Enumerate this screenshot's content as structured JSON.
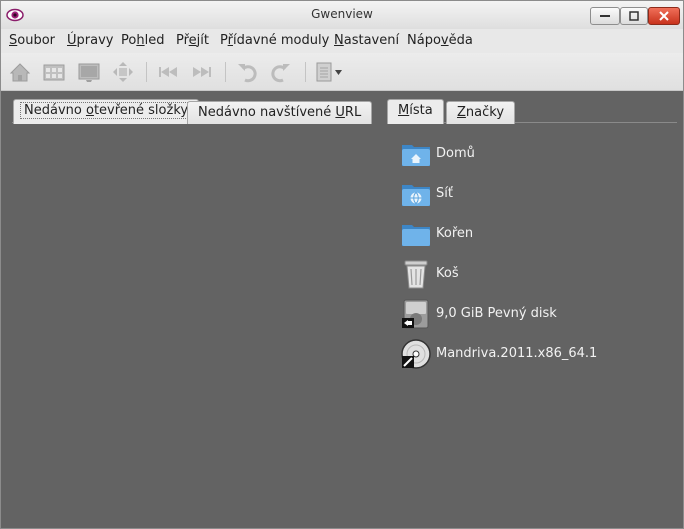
{
  "window": {
    "title": "Gwenview"
  },
  "menu": [
    {
      "pre": "",
      "u": "S",
      "post": "oubor"
    },
    {
      "pre": "",
      "u": "Ú",
      "post": "pravy"
    },
    {
      "pre": "Po",
      "u": "h",
      "post": "led"
    },
    {
      "pre": "Př",
      "u": "e",
      "post": "jít"
    },
    {
      "pre": "P",
      "u": "ř",
      "post": "ídavné moduly"
    },
    {
      "pre": "",
      "u": "N",
      "post": "astavení"
    },
    {
      "pre": "Nápo",
      "u": "v",
      "post": "ěda"
    }
  ],
  "toolbar": {
    "icons": [
      "home-icon",
      "browse-icon",
      "view-icon",
      "fullscreen-icon",
      "first-image-icon",
      "last-image-icon",
      "rotate-left-icon",
      "rotate-right-icon",
      "document-menu-icon"
    ]
  },
  "left_tabs": [
    {
      "pre": "Nedávno ",
      "u": "o",
      "post": "tevřené složky"
    },
    {
      "pre": "Nedávno navštívené ",
      "u": "U",
      "post": "RL"
    }
  ],
  "right_tabs": [
    {
      "pre": "",
      "u": "M",
      "post": "ísta"
    },
    {
      "pre": "",
      "u": "Z",
      "post": "načky"
    }
  ],
  "places": [
    {
      "label": "Domů",
      "icon": "home-folder-icon"
    },
    {
      "label": "Síť",
      "icon": "network-folder-icon"
    },
    {
      "label": "Kořen",
      "icon": "folder-icon"
    },
    {
      "label": "Koš",
      "icon": "trash-icon"
    },
    {
      "label": "9,0 GiB Pevný disk",
      "icon": "hard-disk-icon"
    },
    {
      "label": "Mandriva.2011.x86_64.1",
      "icon": "optical-disc-icon"
    }
  ]
}
